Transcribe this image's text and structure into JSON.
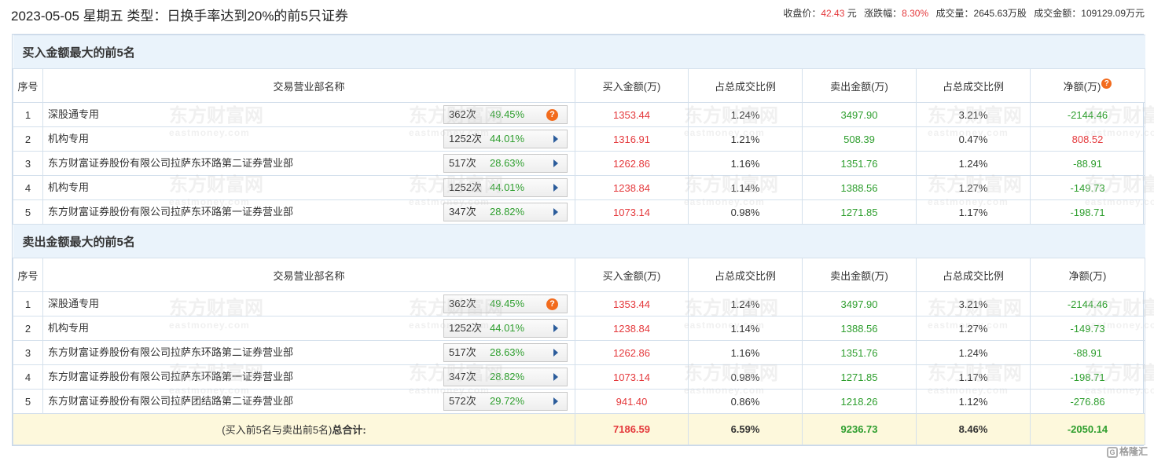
{
  "header": {
    "title": "2023-05-05 星期五 类型：日换手率达到20%的前5只证券",
    "quote": {
      "close_label": "收盘价：",
      "close_value": "42.43",
      "close_unit": "元",
      "change_label": "涨跌幅：",
      "change_value": "8.30%",
      "volume_label": "成交量：",
      "volume_value": "2645.63万股",
      "amount_label": "成交金额：",
      "amount_value": "109129.09万元"
    }
  },
  "columns": {
    "rank": "序号",
    "name": "交易营业部名称",
    "buy": "买入金额(万)",
    "buy_ratio": "占总成交比例",
    "sell": "卖出金额(万)",
    "sell_ratio": "占总成交比例",
    "net": "净额(万)"
  },
  "buy_section": {
    "title": "买入金额最大的前5名",
    "rows": [
      {
        "rank": "1",
        "name": "深股通专用",
        "count": "362次",
        "pct": "49.45%",
        "icon": "question-icon",
        "buy": "1353.44",
        "buy_ratio": "1.24%",
        "sell": "3497.90",
        "sell_ratio": "3.21%",
        "net": "-2144.46",
        "net_color": "#2e9e2e"
      },
      {
        "rank": "2",
        "name": "机构专用",
        "count": "1252次",
        "pct": "44.01%",
        "icon": "arrow-right-icon",
        "buy": "1316.91",
        "buy_ratio": "1.21%",
        "sell": "508.39",
        "sell_ratio": "0.47%",
        "net": "808.52",
        "net_color": "#e4393c"
      },
      {
        "rank": "3",
        "name": "东方财富证券股份有限公司拉萨东环路第二证券营业部",
        "count": "517次",
        "pct": "28.63%",
        "icon": "arrow-right-icon",
        "buy": "1262.86",
        "buy_ratio": "1.16%",
        "sell": "1351.76",
        "sell_ratio": "1.24%",
        "net": "-88.91",
        "net_color": "#2e9e2e"
      },
      {
        "rank": "4",
        "name": "机构专用",
        "count": "1252次",
        "pct": "44.01%",
        "icon": "arrow-right-icon",
        "buy": "1238.84",
        "buy_ratio": "1.14%",
        "sell": "1388.56",
        "sell_ratio": "1.27%",
        "net": "-149.73",
        "net_color": "#2e9e2e"
      },
      {
        "rank": "5",
        "name": "东方财富证券股份有限公司拉萨东环路第一证券营业部",
        "count": "347次",
        "pct": "28.82%",
        "icon": "arrow-right-icon",
        "buy": "1073.14",
        "buy_ratio": "0.98%",
        "sell": "1271.85",
        "sell_ratio": "1.17%",
        "net": "-198.71",
        "net_color": "#2e9e2e"
      }
    ]
  },
  "sell_section": {
    "title": "卖出金额最大的前5名",
    "rows": [
      {
        "rank": "1",
        "name": "深股通专用",
        "count": "362次",
        "pct": "49.45%",
        "icon": "question-icon",
        "buy": "1353.44",
        "buy_ratio": "1.24%",
        "sell": "3497.90",
        "sell_ratio": "3.21%",
        "net": "-2144.46",
        "net_color": "#2e9e2e"
      },
      {
        "rank": "2",
        "name": "机构专用",
        "count": "1252次",
        "pct": "44.01%",
        "icon": "arrow-right-icon",
        "buy": "1238.84",
        "buy_ratio": "1.14%",
        "sell": "1388.56",
        "sell_ratio": "1.27%",
        "net": "-149.73",
        "net_color": "#2e9e2e"
      },
      {
        "rank": "3",
        "name": "东方财富证券股份有限公司拉萨东环路第二证券营业部",
        "count": "517次",
        "pct": "28.63%",
        "icon": "arrow-right-icon",
        "buy": "1262.86",
        "buy_ratio": "1.16%",
        "sell": "1351.76",
        "sell_ratio": "1.24%",
        "net": "-88.91",
        "net_color": "#2e9e2e"
      },
      {
        "rank": "4",
        "name": "东方财富证券股份有限公司拉萨东环路第一证券营业部",
        "count": "347次",
        "pct": "28.82%",
        "icon": "arrow-right-icon",
        "buy": "1073.14",
        "buy_ratio": "0.98%",
        "sell": "1271.85",
        "sell_ratio": "1.17%",
        "net": "-198.71",
        "net_color": "#2e9e2e"
      },
      {
        "rank": "5",
        "name": "东方财富证券股份有限公司拉萨团结路第二证券营业部",
        "count": "572次",
        "pct": "29.72%",
        "icon": "arrow-right-icon",
        "buy": "941.40",
        "buy_ratio": "0.86%",
        "sell": "1218.26",
        "sell_ratio": "1.12%",
        "net": "-276.86",
        "net_color": "#2e9e2e"
      }
    ]
  },
  "total": {
    "label_prefix": "(买入前5名与卖出前5名)",
    "label_bold": "总合计:",
    "buy": "7186.59",
    "buy_ratio": "6.59%",
    "sell": "9236.73",
    "sell_ratio": "8.46%",
    "net": "-2050.14"
  },
  "watermark": {
    "main": "东方财富网",
    "sub": "eastmoney.com"
  },
  "brand": {
    "logo_text": "格隆汇"
  },
  "colors": {
    "red": "#e4393c",
    "green": "#2e9e2e",
    "section_bg": "#eaf3fb",
    "total_bg": "#fdf8dc",
    "icon_orange": "#f26b1d",
    "arrow_blue": "#2b5c9b"
  }
}
